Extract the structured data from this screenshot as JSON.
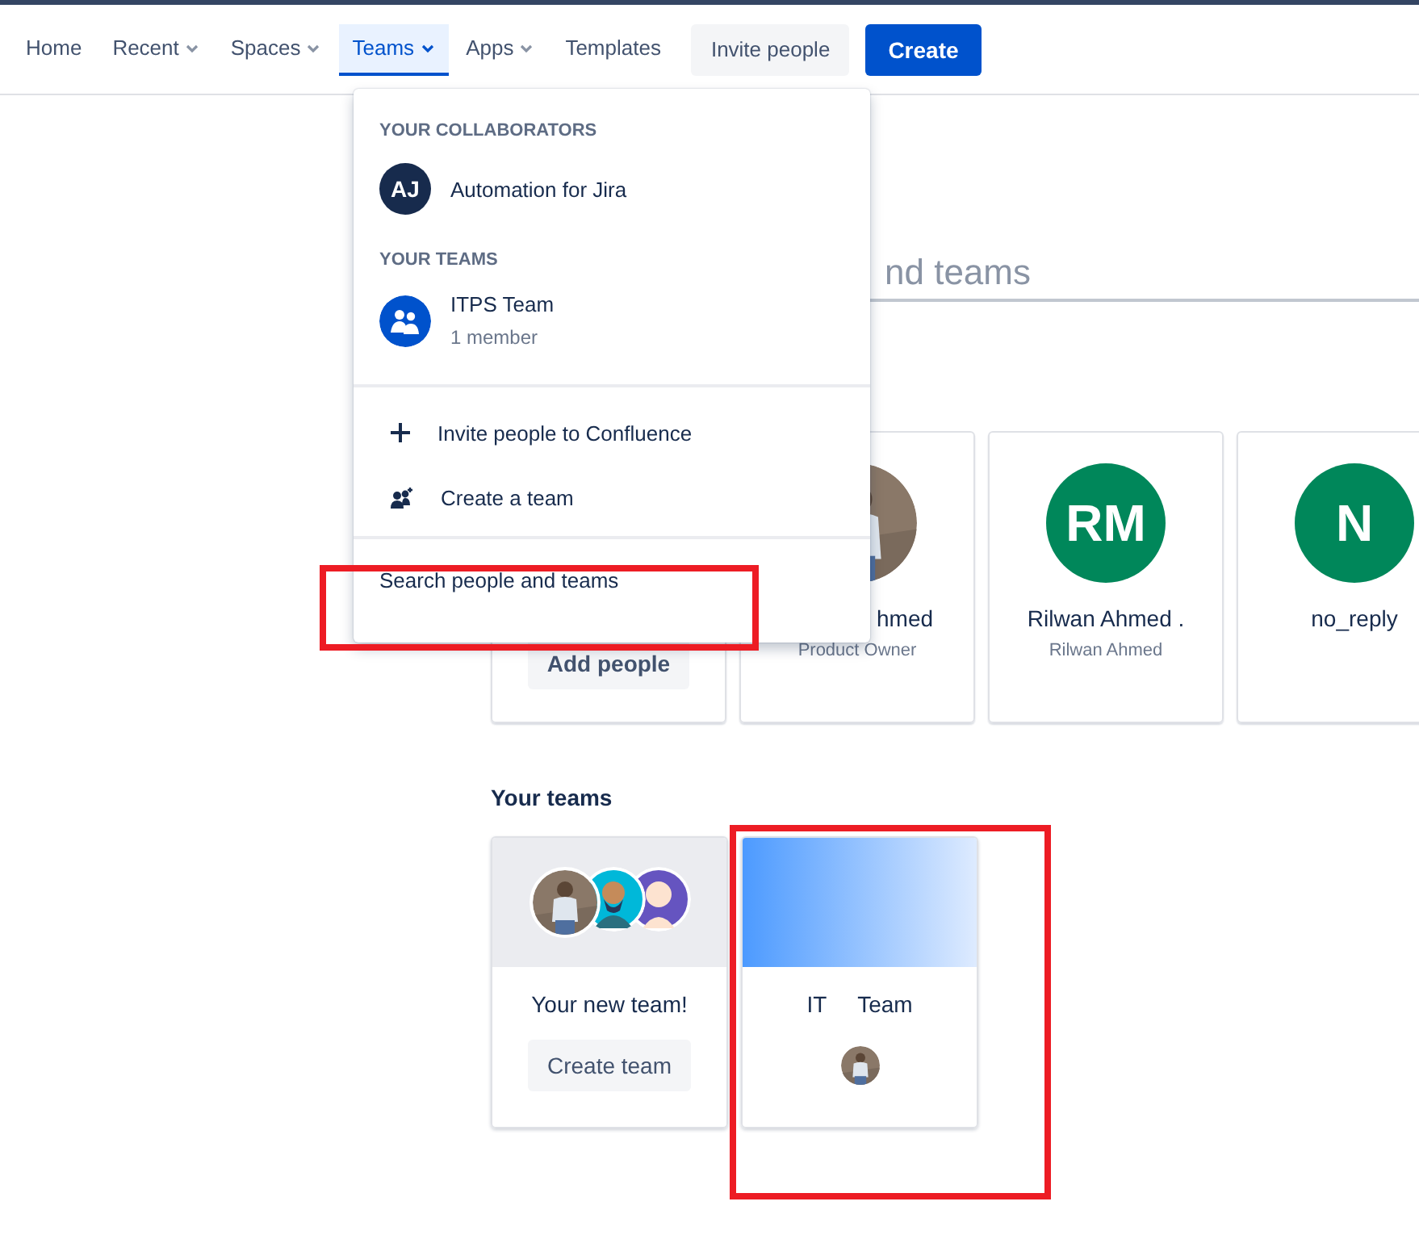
{
  "nav": {
    "items": [
      {
        "label": "Home",
        "has_menu": false,
        "selected": false
      },
      {
        "label": "Recent",
        "has_menu": true,
        "selected": false
      },
      {
        "label": "Spaces",
        "has_menu": true,
        "selected": false
      },
      {
        "label": "Teams",
        "has_menu": true,
        "selected": true
      },
      {
        "label": "Apps",
        "has_menu": true,
        "selected": false
      },
      {
        "label": "Templates",
        "has_menu": false,
        "selected": false
      }
    ],
    "invite_button": "Invite people",
    "create_button": "Create"
  },
  "dropdown": {
    "sections": [
      {
        "heading": "YOUR COLLABORATORS",
        "items": [
          {
            "kind": "person",
            "initials": "AJ",
            "name": "Automation for Jira"
          }
        ]
      },
      {
        "heading": "YOUR TEAMS",
        "items": [
          {
            "kind": "team",
            "name": "ITPS Team",
            "subtitle": "1 member"
          }
        ]
      }
    ],
    "actions": [
      {
        "kind": "invite",
        "label": "Invite people to Confluence"
      },
      {
        "kind": "create-team",
        "label": "Create a team"
      }
    ],
    "search_link": "Search people and teams"
  },
  "search": {
    "value": "nd teams"
  },
  "people": [
    {
      "kind": "add",
      "button": "Add people"
    },
    {
      "name": "hmed",
      "role": "Product Owner"
    },
    {
      "kind": "initials",
      "initials": "RM",
      "color": "#00875a",
      "name": "Rilwan Ahmed .",
      "role": "Rilwan Ahmed"
    },
    {
      "kind": "initials",
      "initials": "N",
      "color": "#00875a",
      "name": "no_reply"
    }
  ],
  "teams_heading": "Your teams",
  "teams": [
    {
      "kind": "new",
      "title": "Your new team!",
      "button": "Create team"
    },
    {
      "kind": "team",
      "title": "IT     Team"
    }
  ],
  "annotations": [
    {
      "kind": "frame"
    },
    {
      "kind": "frame"
    }
  ]
}
